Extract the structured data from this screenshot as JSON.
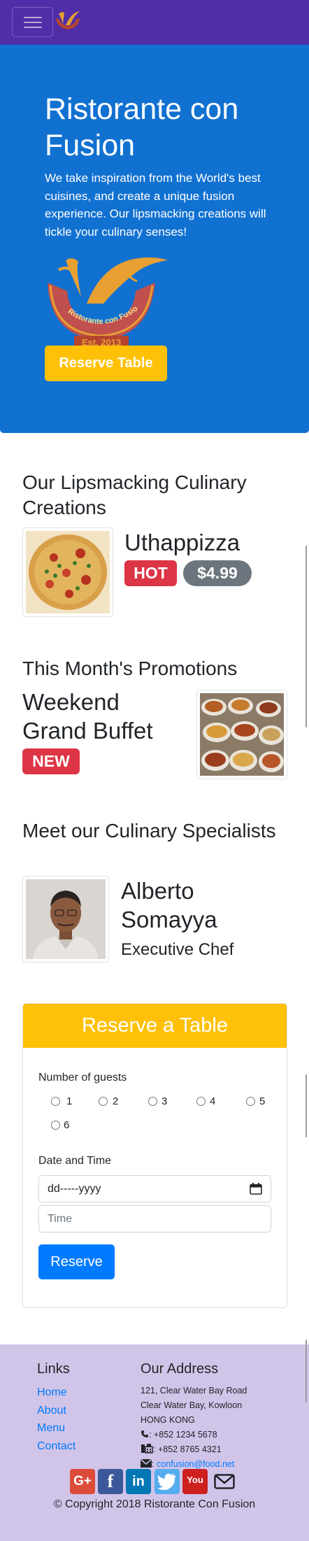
{
  "navbar": {
    "toggler_icon": "hamburger-icon",
    "logo": "brand-logo-icon"
  },
  "jumbotron": {
    "title": "Ristorante con Fusion",
    "text": "We take inspiration from the World's best cuisines, and create a unique fusion experience. Our lipsmacking creations will tickle your culinary senses!",
    "logo_banner": "Ristorante con Fusion",
    "logo_est": "Est. 2013",
    "reserve_label": "Reserve Table"
  },
  "dishes": {
    "heading": "Our Lipsmacking Culinary Creations",
    "name": "Uthappizza",
    "badge": "HOT",
    "price": "$4.99"
  },
  "promotions": {
    "heading": "This Month's Promotions",
    "name_line1": "Weekend",
    "name_line2": "Grand Buffet",
    "badge": "NEW"
  },
  "leaders": {
    "heading": "Meet our Culinary Specialists",
    "name_line1": "Alberto",
    "name_line2": "Somayya",
    "designation": "Executive Chef"
  },
  "reserve": {
    "title": "Reserve a Table",
    "guests_label": "Number of guests",
    "guest_options": [
      "1",
      "2",
      "3",
      "4",
      "5",
      "6"
    ],
    "datetime_label": "Date and Time",
    "date_placeholder": "dd-----yyyy",
    "time_placeholder": "Time",
    "submit_label": "Reserve"
  },
  "footer": {
    "links_heading": "Links",
    "links": [
      "Home",
      "About",
      "Menu",
      "Contact"
    ],
    "address_heading": "Our Address",
    "address_lines": [
      "121, Clear Water Bay Road",
      "Clear Water Bay, Kowloon",
      "HONG KONG"
    ],
    "phone": ": +852 1234 5678",
    "fax": ": +852 8765 4321",
    "email": "confusion@food.net",
    "email_sep": ":",
    "social_icons": [
      "google-plus-icon",
      "facebook-icon",
      "linkedin-icon",
      "twitter-icon",
      "youtube-icon",
      "mail-icon"
    ],
    "social_text": {
      "google": "G+",
      "facebook": "f",
      "linkedin": "in",
      "youtube": "You"
    },
    "copyright": "© Copyright 2018 Ristorante Con Fusion"
  },
  "colors": {
    "navbar": "#512DA8",
    "jumbotron": "#1171D1",
    "warning": "#FFC107",
    "danger": "#DC3545",
    "secondary": "#6C757D",
    "primary": "#007BFF",
    "footer": "#D1C4E9"
  }
}
